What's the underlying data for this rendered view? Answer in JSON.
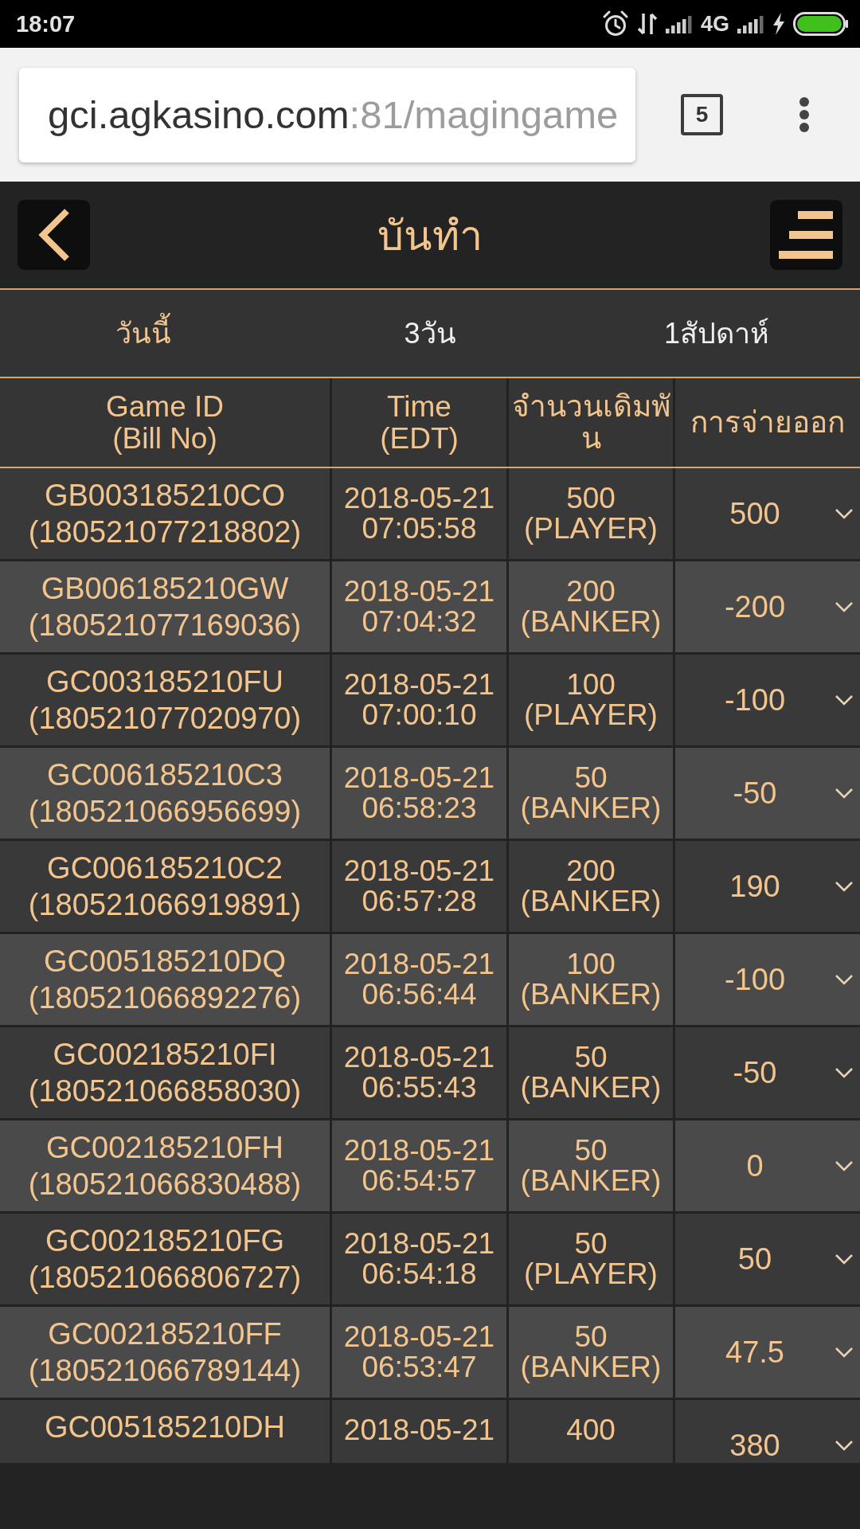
{
  "status_bar": {
    "time": "18:07",
    "network": "4G"
  },
  "browser": {
    "url_host": "gci.agkasino.com",
    "url_path": ":81/magingame",
    "tab_count": "5"
  },
  "header": {
    "title": "บันทำ"
  },
  "filters": [
    {
      "label": "วันนี้",
      "selected": true
    },
    {
      "label": "3วัน",
      "selected": false
    },
    {
      "label": "1สัปดาห์",
      "selected": false
    }
  ],
  "table": {
    "columns": [
      {
        "label": "Game ID",
        "sublabel": "(Bill No)"
      },
      {
        "label": "Time",
        "sublabel": "(EDT)"
      },
      {
        "label": "จำนวนเดิมพัน"
      },
      {
        "label": "การจ่ายออก"
      }
    ],
    "rows": [
      {
        "game_id": "GB003185210CO",
        "bill_no": "(180521077218802)",
        "date": "2018-05-21",
        "time": "07:05:58",
        "bet": "500",
        "side": "(PLAYER)",
        "payout": "500",
        "expanded": false
      },
      {
        "game_id": "GB006185210GW",
        "bill_no": "(180521077169036)",
        "date": "2018-05-21",
        "time": "07:04:32",
        "bet": "200",
        "side": "(BANKER)",
        "payout": "-200",
        "expanded": false
      },
      {
        "game_id": "GC003185210FU",
        "bill_no": "(180521077020970)",
        "date": "2018-05-21",
        "time": "07:00:10",
        "bet": "100",
        "side": "(PLAYER)",
        "payout": "-100",
        "expanded": false
      },
      {
        "game_id": "GC006185210C3",
        "bill_no": "(180521066956699)",
        "date": "2018-05-21",
        "time": "06:58:23",
        "bet": "50",
        "side": "(BANKER)",
        "payout": "-50",
        "expanded": false
      },
      {
        "game_id": "GC006185210C2",
        "bill_no": "(180521066919891)",
        "date": "2018-05-21",
        "time": "06:57:28",
        "bet": "200",
        "side": "(BANKER)",
        "payout": "190",
        "expanded": false
      },
      {
        "game_id": "GC005185210DQ",
        "bill_no": "(180521066892276)",
        "date": "2018-05-21",
        "time": "06:56:44",
        "bet": "100",
        "side": "(BANKER)",
        "payout": "-100",
        "expanded": false
      },
      {
        "game_id": "GC002185210FI",
        "bill_no": "(180521066858030)",
        "date": "2018-05-21",
        "time": "06:55:43",
        "bet": "50",
        "side": "(BANKER)",
        "payout": "-50",
        "expanded": false
      },
      {
        "game_id": "GC002185210FH",
        "bill_no": "(180521066830488)",
        "date": "2018-05-21",
        "time": "06:54:57",
        "bet": "50",
        "side": "(BANKER)",
        "payout": "0",
        "expanded": false
      },
      {
        "game_id": "GC002185210FG",
        "bill_no": "(180521066806727)",
        "date": "2018-05-21",
        "time": "06:54:18",
        "bet": "50",
        "side": "(PLAYER)",
        "payout": "50",
        "expanded": false
      },
      {
        "game_id": "GC002185210FF",
        "bill_no": "(180521066789144)",
        "date": "2018-05-21",
        "time": "06:53:47",
        "bet": "50",
        "side": "(BANKER)",
        "payout": "47.5",
        "expanded": false
      },
      {
        "game_id": "GC005185210DH",
        "date": "2018-05-21",
        "bet": "400",
        "payout": "380",
        "expanded": false
      }
    ]
  }
}
